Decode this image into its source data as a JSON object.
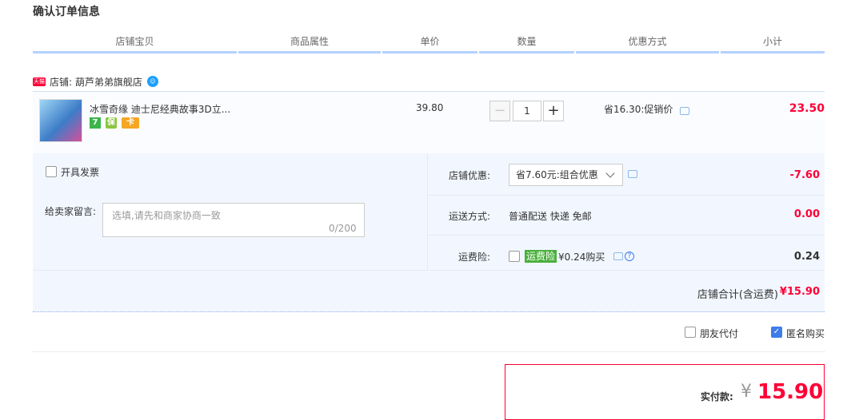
{
  "page": {
    "title": "确认订单信息"
  },
  "columns": [
    "店铺宝贝",
    "商品属性",
    "单价",
    "数量",
    "优惠方式",
    "小计"
  ],
  "shop": {
    "badge": "天猫",
    "label": "店铺: 葫芦弟弟旗舰店"
  },
  "item": {
    "title": "冰雪奇缘 迪士尼经典故事3D立...",
    "tags": [
      "7",
      "保",
      "卡"
    ],
    "unit_price": "39.80",
    "quantity": "1",
    "minus": "−",
    "plus": "+",
    "promo": "省16.30:促销价",
    "subtotal": "23.50"
  },
  "invoice": {
    "label": "开具发票"
  },
  "message": {
    "label": "给卖家留言:",
    "placeholder": "选填,请先和商家协商一致",
    "count": "0/200"
  },
  "shop_discount": {
    "label": "店铺优惠:",
    "selected": "省7.60元:组合优惠",
    "amount": "-7.60"
  },
  "shipping": {
    "label": "运送方式:",
    "value": "普通配送 快递 免邮",
    "amount": "0.00"
  },
  "insurance": {
    "label": "运费险:",
    "tag": "运费险",
    "text": "¥0.24购买",
    "amount": "0.24",
    "help": "?"
  },
  "shop_total": {
    "label": "店铺合计(含运费)",
    "value": "¥15.90"
  },
  "options": {
    "friend_pay": "朋友代付",
    "anonymous": "匿名购买",
    "check": "✓"
  },
  "payment": {
    "label": "实付款:",
    "currency": "¥",
    "amount": "15.90"
  },
  "colors": {
    "accent_red": "#ff0036",
    "header_border": "#b2d1ff",
    "panel_bg": "#f2f7ff",
    "checkbox_blue": "#3d7dea"
  }
}
